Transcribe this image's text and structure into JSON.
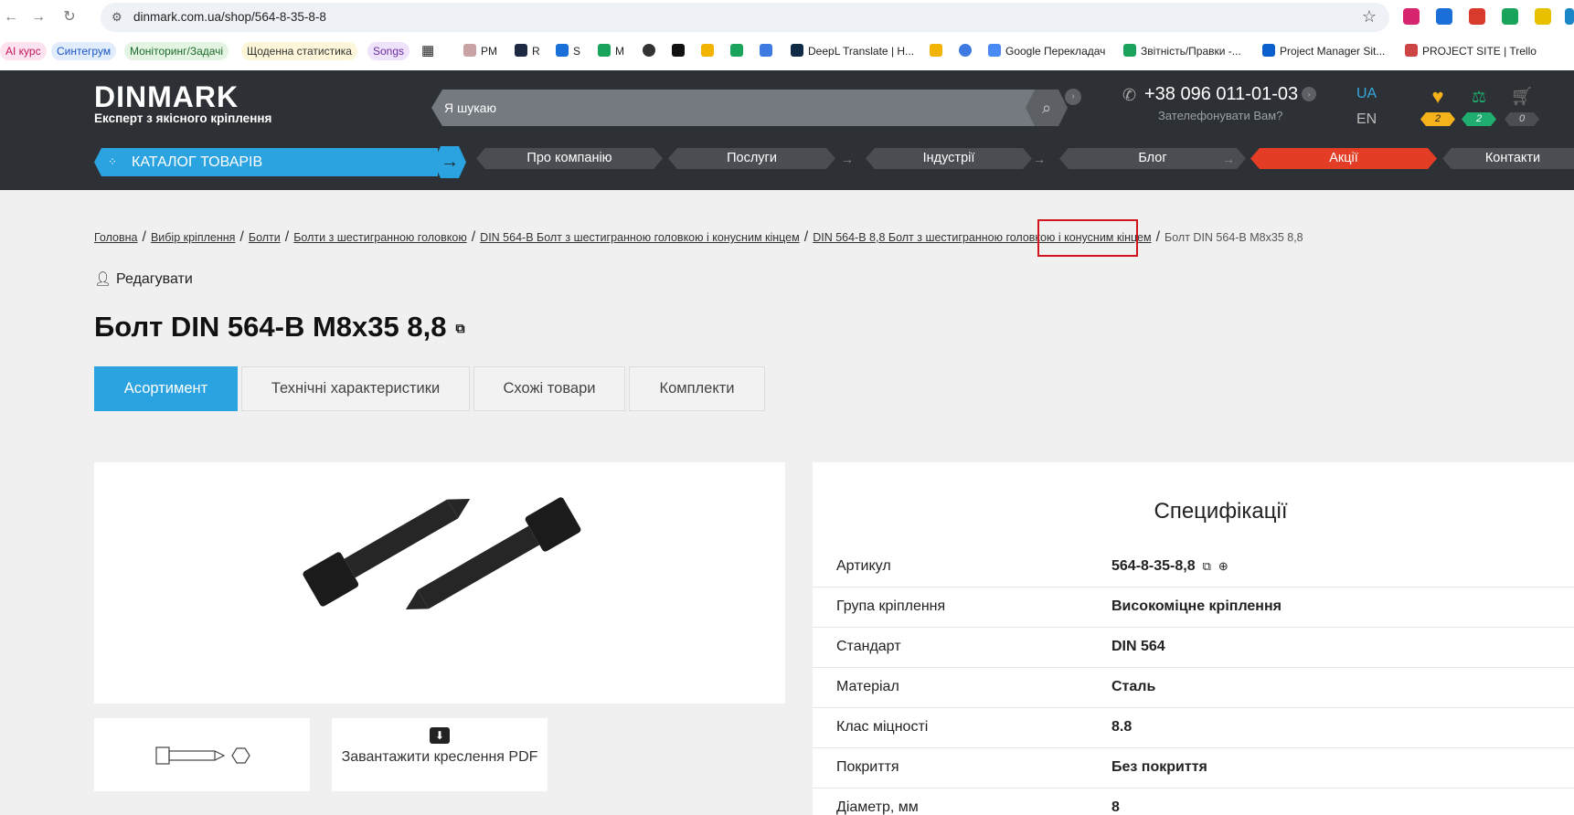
{
  "browser": {
    "url": "dinmark.com.ua/shop/564-8-35-8-8",
    "bookmarks": [
      {
        "label": "AI курс",
        "bg": "#fde3ef",
        "color": "#c1185b"
      },
      {
        "label": "Синтегрум",
        "bg": "#e1ecfd",
        "color": "#1a56c4"
      },
      {
        "label": "Моніторинг/Задачі",
        "bg": "#e3f4e3",
        "color": "#1d6b2a"
      },
      {
        "label": "Щоденна статистика",
        "bg": "#fdf6d8",
        "color": "#333"
      },
      {
        "label": "Songs",
        "bg": "#efe3fb",
        "color": "#6a2ca3"
      },
      {
        "label": "PM"
      },
      {
        "label": "R"
      },
      {
        "label": "S"
      },
      {
        "label": "M"
      },
      {
        "label": "DeepL Translate | H..."
      },
      {
        "label": "Google Перекладач"
      },
      {
        "label": "Звітність/Правки -..."
      },
      {
        "label": "Project Manager Sit..."
      },
      {
        "label": "PROJECT SITE | Trello"
      }
    ]
  },
  "header": {
    "logo": "DINMARK",
    "tagline": "Експерт з якісного кріплення",
    "search_placeholder": "Я шукаю",
    "phone": "+38 096 011-01-03",
    "callback": "Зателефонувати Вам?",
    "lang_ua": "UA",
    "lang_en": "EN",
    "favorites_count": "2",
    "compare_count": "2",
    "cart_count": "0",
    "catalog": "КАТАЛОГ ТОВАРІВ",
    "nav": [
      "Про компанію",
      "Послуги",
      "Індустрії",
      "Блог",
      "Акції",
      "Контакти"
    ]
  },
  "breadcrumbs": {
    "items": [
      "Головна",
      "Вибір кріплення",
      "Болти",
      "Болти з шестигранною головкою",
      "DIN 564-B Болт з шестигранною головкою і конусним кінцем",
      "DIN 564-B 8,8 Болт з шестигранною головкою і конусним кінцем"
    ],
    "current": "Болт DIN 564-B M8x35 8,8"
  },
  "product": {
    "edit": "Редагувати",
    "title": "Болт DIN 564-B M8x35 8,8",
    "tabs": [
      "Асортимент",
      "Технічні характеристики",
      "Схожі товари",
      "Комплекти"
    ],
    "download_pdf": "Завантажити креслення PDF"
  },
  "specs": {
    "title": "Специфікації",
    "rows": [
      {
        "k": "Артикул",
        "v": "564-8-35-8,8"
      },
      {
        "k": "Група кріплення",
        "v": "Високоміцне кріплення"
      },
      {
        "k": "Стандарт",
        "v": "DIN 564"
      },
      {
        "k": "Матеріал",
        "v": "Сталь"
      },
      {
        "k": "Клас міцності",
        "v": "8.8"
      },
      {
        "k": "Покриття",
        "v": "Без покриття"
      },
      {
        "k": "Діаметр, мм",
        "v": "8"
      }
    ]
  },
  "colors": {
    "header_bg": "#2d3034",
    "accent_blue": "#2aa3e0",
    "promo_red": "#e43d26",
    "fav_badge": "#f6b21b",
    "compare_badge": "#1fae6f",
    "highlight": "#d0161b"
  }
}
